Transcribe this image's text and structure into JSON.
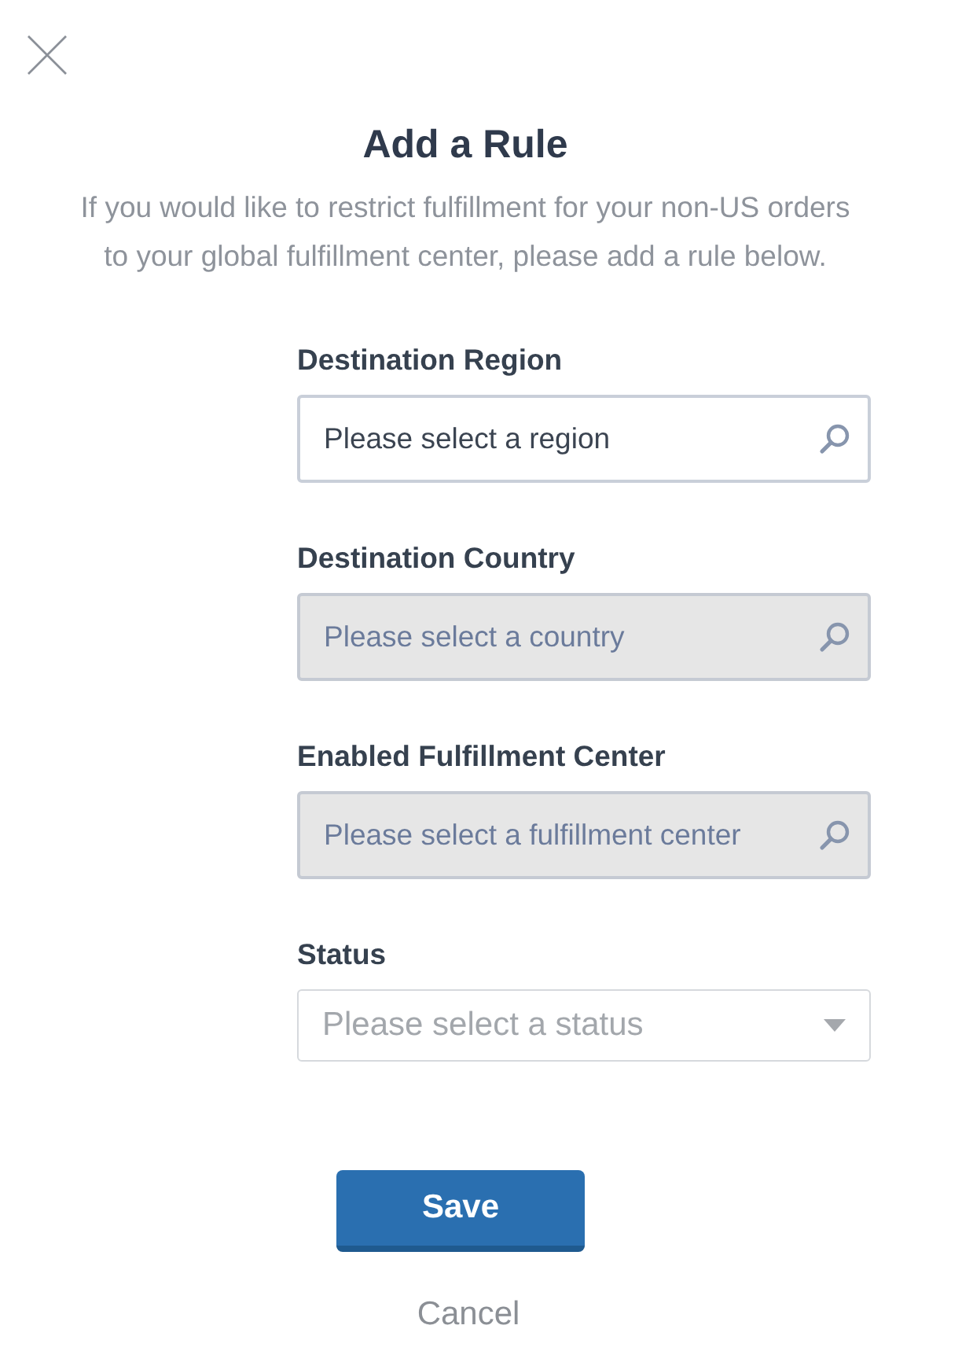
{
  "dialog": {
    "title": "Add a Rule",
    "description": "If you would like to restrict fulfillment for your non-US orders to your global fulfillment center, please add a rule below."
  },
  "fields": [
    {
      "label": "Destination Region",
      "kind": "search",
      "placeholder": "Please select a region",
      "disabled": false
    },
    {
      "label": "Destination Country",
      "kind": "search",
      "placeholder": "Please select a country",
      "disabled": true
    },
    {
      "label": "Enabled Fulfillment Center",
      "kind": "search",
      "placeholder": "Please select a fulfillment center",
      "disabled": true
    },
    {
      "label": "Status",
      "kind": "select",
      "placeholder": "Please select a status",
      "disabled": false
    }
  ],
  "buttons": {
    "save": "Save",
    "cancel": "Cancel"
  }
}
